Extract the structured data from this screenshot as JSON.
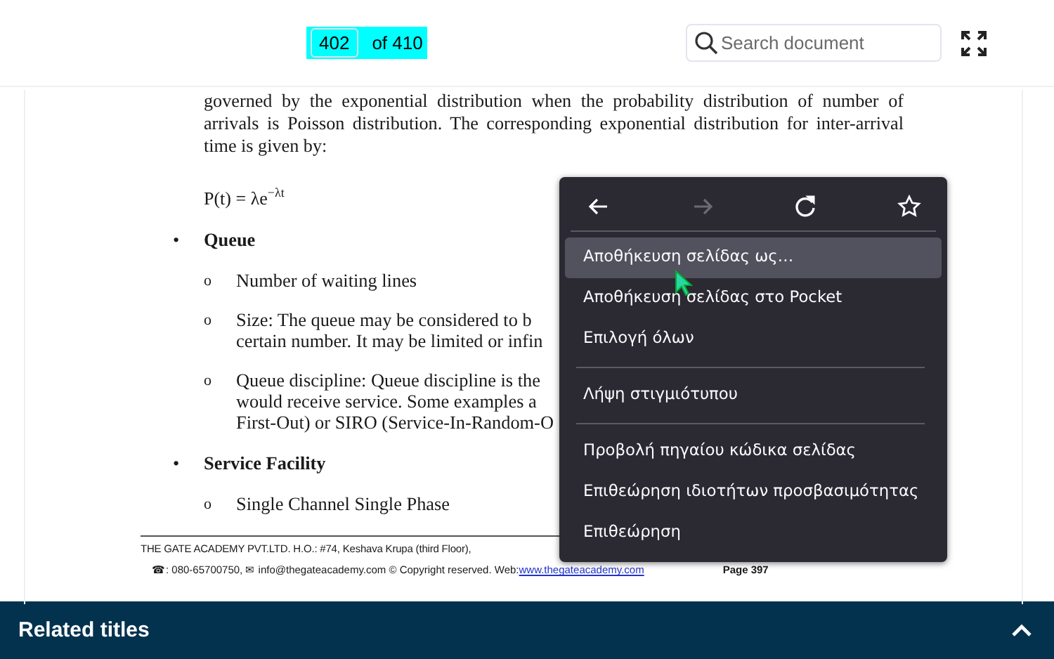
{
  "toolbar": {
    "page_input": "402",
    "page_total": "of 410",
    "search": {
      "placeholder": "Search document"
    }
  },
  "document": {
    "paragraph": "governed by the exponential distribution when the probability distribution of number of arrivals is Poisson distribution. The corresponding exponential distribution for inter-arrival time is given by:",
    "formula": "P(t) = λe$^{−λt}$",
    "sections": [
      {
        "marker": "•",
        "title": "Queue",
        "items": [
          {
            "marker": "o",
            "lines": [
              "Number of waiting lines"
            ]
          },
          {
            "marker": "o",
            "lines": [
              "Size: The queue may be considered to b",
              "certain number. It may be limited or infin"
            ]
          },
          {
            "marker": "o",
            "lines": [
              "Queue discipline: Queue discipline is the",
              "would receive service. Some examples a",
              "First-Out) or SIRO (Service-In-Random-O"
            ]
          }
        ]
      },
      {
        "marker": "•",
        "title": "Service Facility",
        "items": [
          {
            "marker": "o",
            "lines": [
              "Single Channel Single Phase"
            ]
          }
        ]
      }
    ],
    "footer": {
      "line_1": "THE GATE ACADEMY PVT.LTD.  H.O.: #74, Keshava Krupa (third Floor),",
      "line_2": "☎: 080-65700750, ✉ info@thegateacademy.com © Copyright reserved. Web: ",
      "link": "www.thegateacademy.com",
      "page": "Page 397"
    }
  },
  "context_menu": {
    "nav": [
      {
        "kind": "back",
        "disabled": false
      },
      {
        "kind": "forward",
        "disabled": true
      },
      {
        "kind": "reload",
        "disabled": false
      },
      {
        "kind": "bookmark",
        "disabled": false
      }
    ],
    "items": [
      {
        "kind": "item",
        "label": "Αποθήκευση σελίδας ως…",
        "selected": true
      },
      {
        "kind": "item",
        "label": "Αποθήκευση σελίδας στο Pocket",
        "selected": false
      },
      {
        "kind": "item",
        "label": "Επιλογή όλων",
        "selected": false
      },
      {
        "kind": "separator"
      },
      {
        "kind": "item",
        "label": "Λήψη στιγμιότυπου",
        "selected": false
      },
      {
        "kind": "separator"
      },
      {
        "kind": "item",
        "label": "Προβολή πηγαίου κώδικα σελίδας",
        "selected": false
      },
      {
        "kind": "item",
        "label": "Επιθεώρηση ιδιοτήτων προσβασιμότητας",
        "selected": false
      },
      {
        "kind": "item",
        "label": "Επιθεώρηση",
        "selected": false
      }
    ]
  },
  "bottom_bar": {
    "title": "Related titles",
    "expanded": false
  }
}
